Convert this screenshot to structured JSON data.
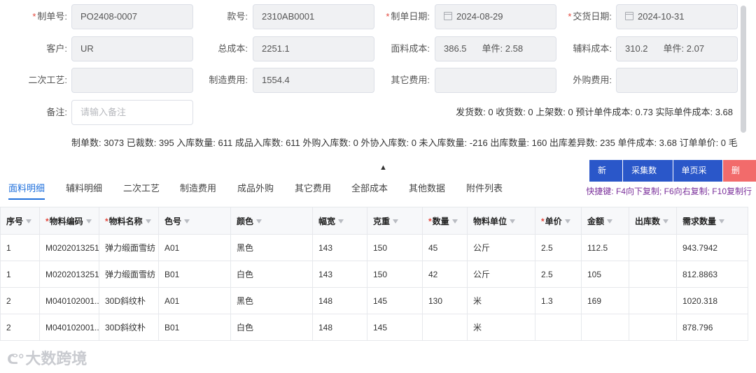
{
  "form": {
    "order_no": {
      "label": "制单号:",
      "value": "PO2408-0007"
    },
    "style_no": {
      "label": "款号:",
      "value": "2310AB0001"
    },
    "order_date": {
      "label": "制单日期:",
      "value": "2024-08-29"
    },
    "delivery_date": {
      "label": "交货日期:",
      "value": "2024-10-31"
    },
    "customer": {
      "label": "客户:",
      "value": "UR"
    },
    "total_cost": {
      "label": "总成本:",
      "value": "2251.1"
    },
    "fabric_cost": {
      "label": "面料成本:",
      "value": "386.5",
      "unit_label": "单件:",
      "unit_value": "2.58"
    },
    "accessory_cost": {
      "label": "辅料成本:",
      "value": "310.2",
      "unit_label": "单件:",
      "unit_value": "2.07"
    },
    "secondary_process": {
      "label": "二次工艺:",
      "value": ""
    },
    "manufacturing_cost": {
      "label": "制造费用:",
      "value": "1554.4"
    },
    "other_cost": {
      "label": "其它费用:",
      "value": ""
    },
    "outsourcing_cost": {
      "label": "外购费用:",
      "value": ""
    },
    "remark": {
      "label": "备注:",
      "placeholder": "请输入备注"
    }
  },
  "summary1": "发货数: 0 收货数: 0 上架数: 0 预计单件成本: 0.73 实际单件成本: 3.68",
  "summary2": "制单数: 3073 已裁数: 395 入库数量: 611 成品入库数: 611 外购入库数: 0 外协入库数: 0 未入库数量: -216 出库数量: 160 出库差异数: 235 单件成本: 3.68 订单单价: 0 毛",
  "collapse_arrow": "▲",
  "tabs": [
    "面料明细",
    "辅料明细",
    "二次工艺",
    "制造费用",
    "成品外购",
    "其它费用",
    "全部成本",
    "其他数据",
    "附件列表"
  ],
  "buttons": {
    "add": "新增",
    "collect": "采集数据",
    "page_collect": "单页采集",
    "delete": "删除"
  },
  "shortcut_hint": "快捷键: F4向下复制; F6向右复制; F10复制行",
  "table": {
    "columns": [
      {
        "label": "序号",
        "required": false
      },
      {
        "label": "物料编码",
        "required": true
      },
      {
        "label": "物料名称",
        "required": true
      },
      {
        "label": "色号",
        "required": false
      },
      {
        "label": "颜色",
        "required": false
      },
      {
        "label": "幅宽",
        "required": false
      },
      {
        "label": "克重",
        "required": false
      },
      {
        "label": "数量",
        "required": true
      },
      {
        "label": "物料单位",
        "required": false
      },
      {
        "label": "单价",
        "required": true
      },
      {
        "label": "金额",
        "required": false
      },
      {
        "label": "出库数",
        "required": false
      },
      {
        "label": "需求数量",
        "required": false
      }
    ],
    "rows": [
      [
        "1",
        "M0202013251",
        "弹力缎面雪纺",
        "A01",
        "黑色",
        "143",
        "150",
        "45",
        "公斤",
        "2.5",
        "112.5",
        "",
        "943.7942"
      ],
      [
        "1",
        "M0202013251",
        "弹力缎面雪纺",
        "B01",
        "白色",
        "143",
        "150",
        "42",
        "公斤",
        "2.5",
        "105",
        "",
        "812.8863"
      ],
      [
        "2",
        "M040102001...",
        "30D斜纹朴",
        "A01",
        "黑色",
        "148",
        "145",
        "130",
        "米",
        "1.3",
        "169",
        "",
        "1020.318"
      ],
      [
        "2",
        "M040102001...",
        "30D斜纹朴",
        "B01",
        "白色",
        "148",
        "145",
        "",
        "米",
        "",
        "",
        "",
        "878.796"
      ]
    ]
  },
  "watermark_logo": "大数跨境"
}
